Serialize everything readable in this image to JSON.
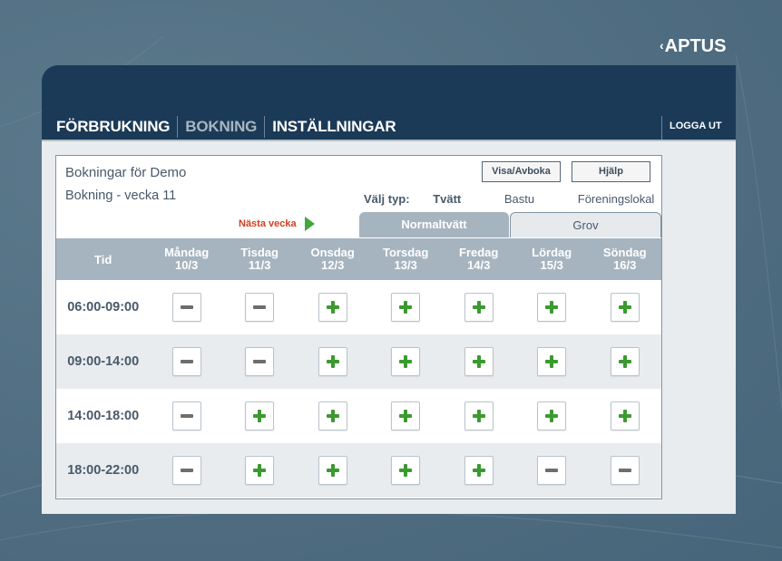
{
  "brand": {
    "logo": "APTUS"
  },
  "nav": {
    "items": [
      {
        "label": "FÖRBRUKNING",
        "active": false
      },
      {
        "label": "BOKNING",
        "active": true
      },
      {
        "label": "INSTÄLLNINGAR",
        "active": false
      }
    ],
    "logout": "LOGGA UT"
  },
  "booking": {
    "title": "Bokningar för Demo",
    "week_label": "Bokning - vecka 11",
    "buttons": {
      "view_cancel": "Visa/Avboka",
      "help": "Hjälp"
    },
    "type_select": {
      "label": "Välj typ:",
      "options": [
        "Tvätt",
        "Bastu",
        "Föreningslokal"
      ],
      "selected": "Tvätt"
    },
    "next_week": "Nästa vecka",
    "tabs": [
      {
        "label": "Normaltvätt",
        "active": true
      },
      {
        "label": "Grov",
        "active": false
      }
    ],
    "columns": {
      "time_header": "Tid",
      "days": [
        {
          "name": "Måndag",
          "date": "10/3"
        },
        {
          "name": "Tisdag",
          "date": "11/3"
        },
        {
          "name": "Onsdag",
          "date": "12/3"
        },
        {
          "name": "Torsdag",
          "date": "13/3"
        },
        {
          "name": "Fredag",
          "date": "14/3"
        },
        {
          "name": "Lördag",
          "date": "15/3"
        },
        {
          "name": "Söndag",
          "date": "16/3"
        }
      ]
    },
    "slots": [
      {
        "time": "06:00-09:00",
        "status": [
          "unavailable",
          "unavailable",
          "available",
          "available",
          "available",
          "available",
          "available"
        ]
      },
      {
        "time": "09:00-14:00",
        "status": [
          "unavailable",
          "unavailable",
          "available",
          "available",
          "available",
          "available",
          "available"
        ]
      },
      {
        "time": "14:00-18:00",
        "status": [
          "unavailable",
          "available",
          "available",
          "available",
          "available",
          "available",
          "available"
        ]
      },
      {
        "time": "18:00-22:00",
        "status": [
          "unavailable",
          "available",
          "available",
          "available",
          "available",
          "unavailable",
          "unavailable"
        ]
      }
    ]
  },
  "colors": {
    "header_bg": "#1b3a57",
    "table_header_bg": "#a6b4bf",
    "available_green": "#3b9a2f",
    "next_week_red": "#d2401f"
  }
}
